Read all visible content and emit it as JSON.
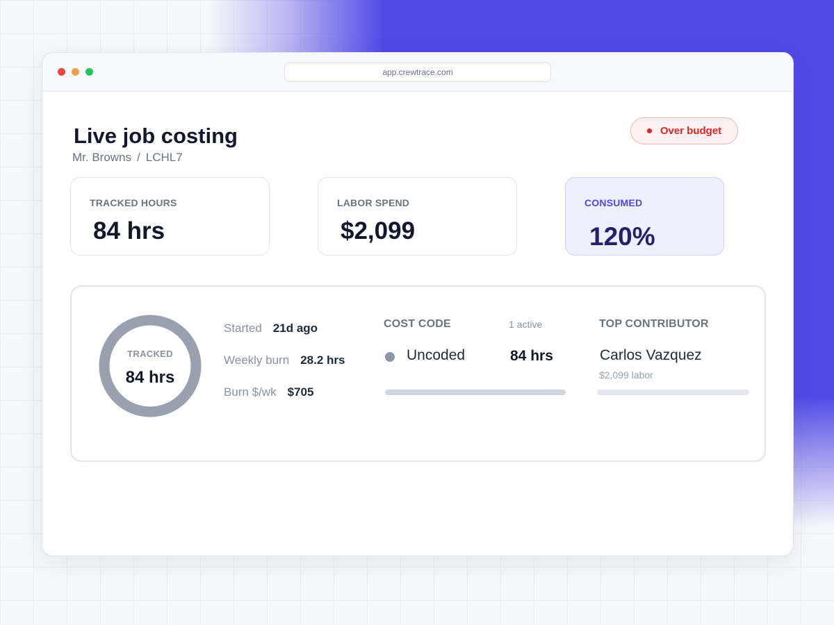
{
  "browser": {
    "url": "app.crewtrace.com"
  },
  "header": {
    "title": "Live job costing",
    "breadcrumb": {
      "client": "Mr. Browns",
      "separator": "/",
      "job": "LCHL7"
    },
    "status": {
      "label": "Over budget",
      "color": "#dc2626"
    }
  },
  "stats": {
    "hours": {
      "label": "TRACKED HOURS",
      "value": "84 hrs"
    },
    "spend": {
      "label": "LABOR SPEND",
      "value": "$2,099"
    },
    "consumed": {
      "label": "CONSUMED",
      "value": "120%",
      "accent": "#4f46e5"
    }
  },
  "summary": {
    "donut": {
      "label": "TRACKED",
      "value": "84 hrs",
      "fill_fraction": 1.0,
      "color": "#9aa1ae"
    },
    "started": {
      "label": "Started",
      "value": "21d ago"
    },
    "weekly_burn": {
      "label": "Weekly burn",
      "value": "28.2 hrs"
    },
    "burn_cost": {
      "label": "Burn $/wk",
      "value": "$705"
    }
  },
  "cost_code": {
    "heading": "COST CODE",
    "active_count": "1 active",
    "items": [
      {
        "name": "Uncoded",
        "hours": "84 hrs",
        "share_fraction": 1.0
      }
    ]
  },
  "top_contributor": {
    "heading": "TOP CONTRIBUTOR",
    "name": "Carlos Vazquez",
    "labor": "$2,099 labor",
    "share_fraction": 1.0
  }
}
